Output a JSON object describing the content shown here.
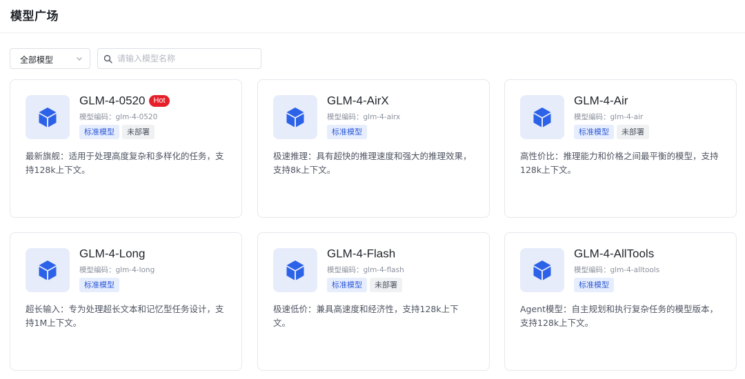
{
  "header": {
    "title": "模型广场"
  },
  "filter": {
    "selected": "全部模型"
  },
  "search": {
    "placeholder": "请输入模型名称"
  },
  "colors": {
    "accent": "#2f5bd8",
    "hot_badge": "#e5202a",
    "logo_bg": "#e7ecfb"
  },
  "cards": [
    {
      "name": "GLM-4-0520",
      "hot": "Hot",
      "code": "模型编码：glm-4-0520",
      "tags": [
        "标准模型",
        "未部署"
      ],
      "description": "最新旗舰：适用于处理高度复杂和多样化的任务，支持128k上下文。",
      "icon": "cube-icon"
    },
    {
      "name": "GLM-4-AirX",
      "code": "模型编码：glm-4-airx",
      "tags": [
        "标准模型"
      ],
      "description": "极速推理：具有超快的推理速度和强大的推理效果，支持8k上下文。",
      "icon": "cube-icon"
    },
    {
      "name": "GLM-4-Air",
      "code": "模型编码：glm-4-air",
      "tags": [
        "标准模型",
        "未部署"
      ],
      "description": "高性价比：推理能力和价格之间最平衡的模型，支持128k上下文。",
      "icon": "cube-icon"
    },
    {
      "name": "GLM-4-Long",
      "code": "模型编码：glm-4-long",
      "tags": [
        "标准模型"
      ],
      "description": "超长输入：专为处理超长文本和记忆型任务设计，支持1M上下文。",
      "icon": "cube-icon"
    },
    {
      "name": "GLM-4-Flash",
      "code": "模型编码：glm-4-flash",
      "tags": [
        "标准模型",
        "未部署"
      ],
      "description": "极速低价：兼具高速度和经济性，支持128k上下文。",
      "icon": "cube-icon"
    },
    {
      "name": "GLM-4-AllTools",
      "code": "模型编码：glm-4-alltools",
      "tags": [
        "标准模型"
      ],
      "description": "Agent模型：自主规划和执行复杂任务的模型版本，支持128k上下文。",
      "icon": "cube-icon"
    }
  ]
}
